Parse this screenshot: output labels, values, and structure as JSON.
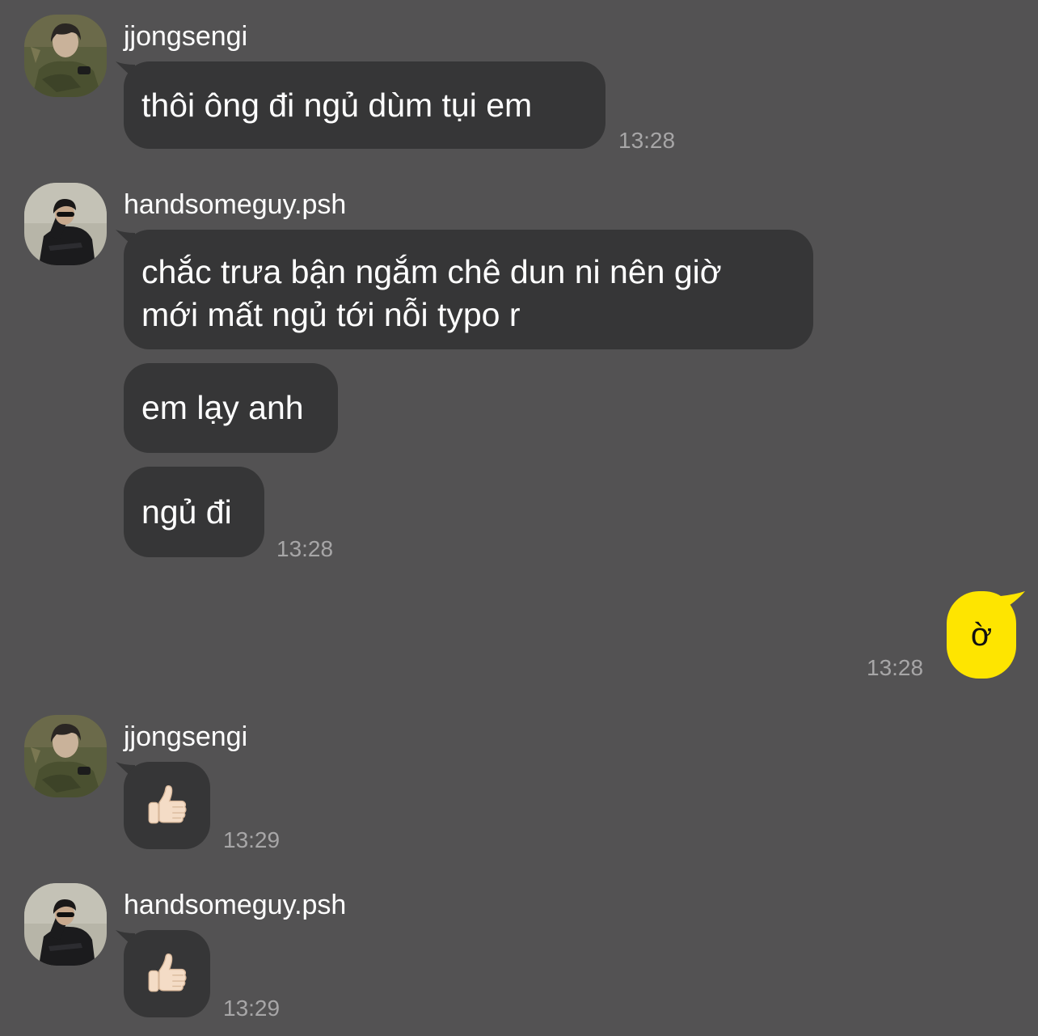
{
  "colors": {
    "background": "#535253",
    "incoming_bubble": "#363637",
    "outgoing_bubble": "#fee500",
    "timestamp": "#a7a6a7"
  },
  "messages": [
    {
      "sender": "jjongsengi",
      "avatar": "jjongsengi-avatar",
      "bubbles": [
        {
          "text": "thôi ông đi ngủ dùm tụi em"
        }
      ],
      "time": "13:28"
    },
    {
      "sender": "handsomeguy.psh",
      "avatar": "handsomeguy-avatar",
      "bubbles": [
        {
          "lines": [
            "chắc trưa bận ngắm chê dun ni nên giờ",
            "mới mất ngủ tới nỗi typo r"
          ]
        },
        {
          "text": "em lạy anh"
        },
        {
          "text": "ngủ đi"
        }
      ],
      "time": "13:28"
    },
    {
      "sender": "me",
      "bubbles": [
        {
          "text": "ờ"
        }
      ],
      "time": "13:28"
    },
    {
      "sender": "jjongsengi",
      "avatar": "jjongsengi-avatar",
      "bubbles": [
        {
          "emoji": "thumbs-up-icon"
        }
      ],
      "time": "13:29"
    },
    {
      "sender": "handsomeguy.psh",
      "avatar": "handsomeguy-avatar",
      "bubbles": [
        {
          "emoji": "thumbs-up-icon"
        }
      ],
      "time": "13:29"
    }
  ]
}
